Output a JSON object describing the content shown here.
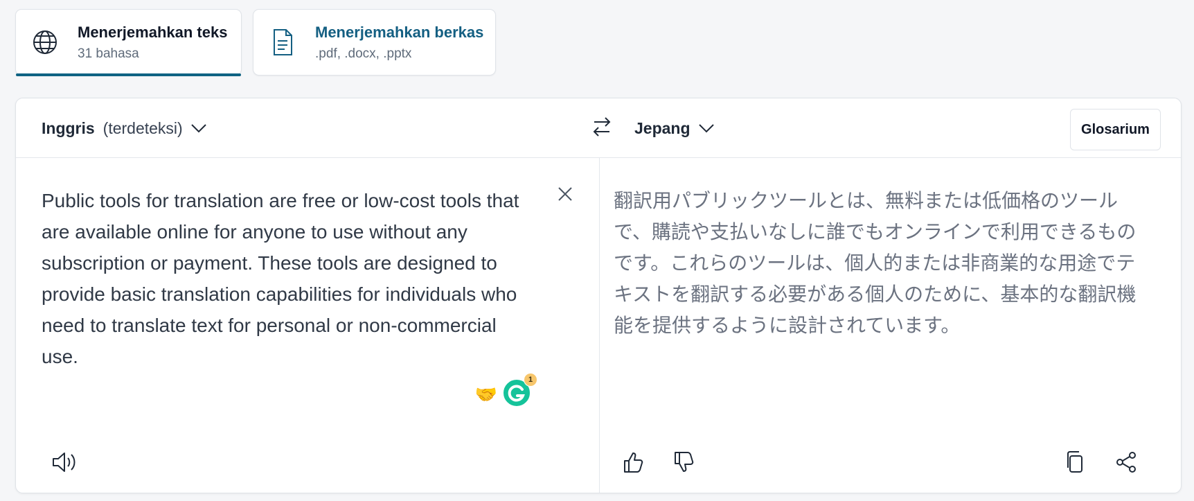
{
  "tabs": [
    {
      "title": "Menerjemahkan teks",
      "subtitle": "31 bahasa",
      "icon": "globe-icon",
      "active": true
    },
    {
      "title": "Menerjemahkan berkas",
      "subtitle": ".pdf, .docx, .pptx",
      "icon": "document-icon",
      "active": false
    }
  ],
  "source": {
    "language": "Inggris",
    "detected_label": "(terdeteksi)",
    "text": "Public tools for translation are free or low-cost tools that are available online for anyone to use without any subscription or payment. These tools are designed to provide basic translation capabilities for individuals who need to translate text for personal or non-commercial use.",
    "emoji": "🤝",
    "grammarly_count": "1"
  },
  "target": {
    "language": "Jepang",
    "text": "翻訳用パブリックツールとは、無料または低価格のツールで、購読や支払いなしに誰でもオンラインで利用できるものです。これらのツールは、個人的または非商業的な用途でテキストを翻訳する必要がある個人のために、基本的な翻訳機能を提供するように設計されています。"
  },
  "toolbar": {
    "glossary_label": "Glosarium"
  },
  "icons": {
    "swap": "swap-icon",
    "clear": "close-icon",
    "speaker": "speaker-icon",
    "thumbs_up": "thumbs-up-icon",
    "thumbs_down": "thumbs-down-icon",
    "copy": "copy-icon",
    "share": "share-icon",
    "grammarly": "grammarly-icon"
  },
  "colors": {
    "accent": "#0f6383",
    "link": "#145f82",
    "grammarly": "#15c39a"
  }
}
